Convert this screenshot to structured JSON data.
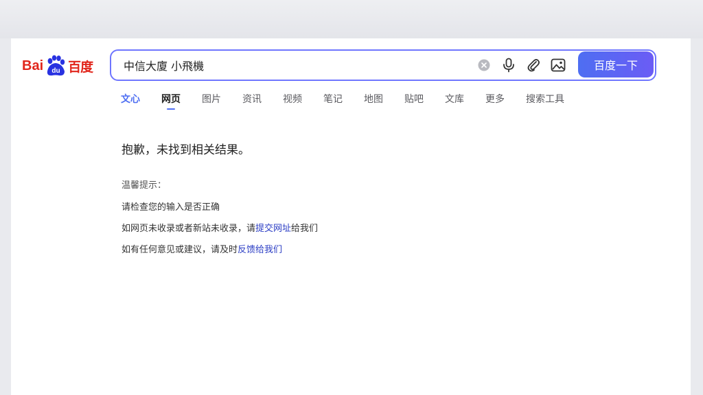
{
  "logo": {
    "brand_latin_a": "Bai",
    "brand_paw": "du",
    "brand_cn": "百度"
  },
  "search": {
    "value": "中信大廈 小飛機",
    "button_label": "百度一下"
  },
  "tabs": [
    {
      "label": "文心"
    },
    {
      "label": "网页"
    },
    {
      "label": "图片"
    },
    {
      "label": "资讯"
    },
    {
      "label": "视频"
    },
    {
      "label": "笔记"
    },
    {
      "label": "地图"
    },
    {
      "label": "贴吧"
    },
    {
      "label": "文库"
    },
    {
      "label": "更多"
    },
    {
      "label": "搜索工具"
    }
  ],
  "result": {
    "heading": "抱歉，未找到相关结果。",
    "tips_title": "温馨提示：",
    "tip1": "请检查您的输入是否正确",
    "tip2_prefix": "如网页未收录或者新站未收录，请",
    "tip2_link": "提交网址",
    "tip2_suffix": "给我们",
    "tip3_prefix": "如有任何意见或建议，请及时",
    "tip3_link": "反馈给我们"
  },
  "icons": [
    "clear-icon",
    "microphone-icon",
    "attachment-icon",
    "image-search-icon"
  ],
  "colors": {
    "brand_red": "#e1251b",
    "accent_blue": "#4e6ef2",
    "link_blue": "#2a3cc4"
  }
}
